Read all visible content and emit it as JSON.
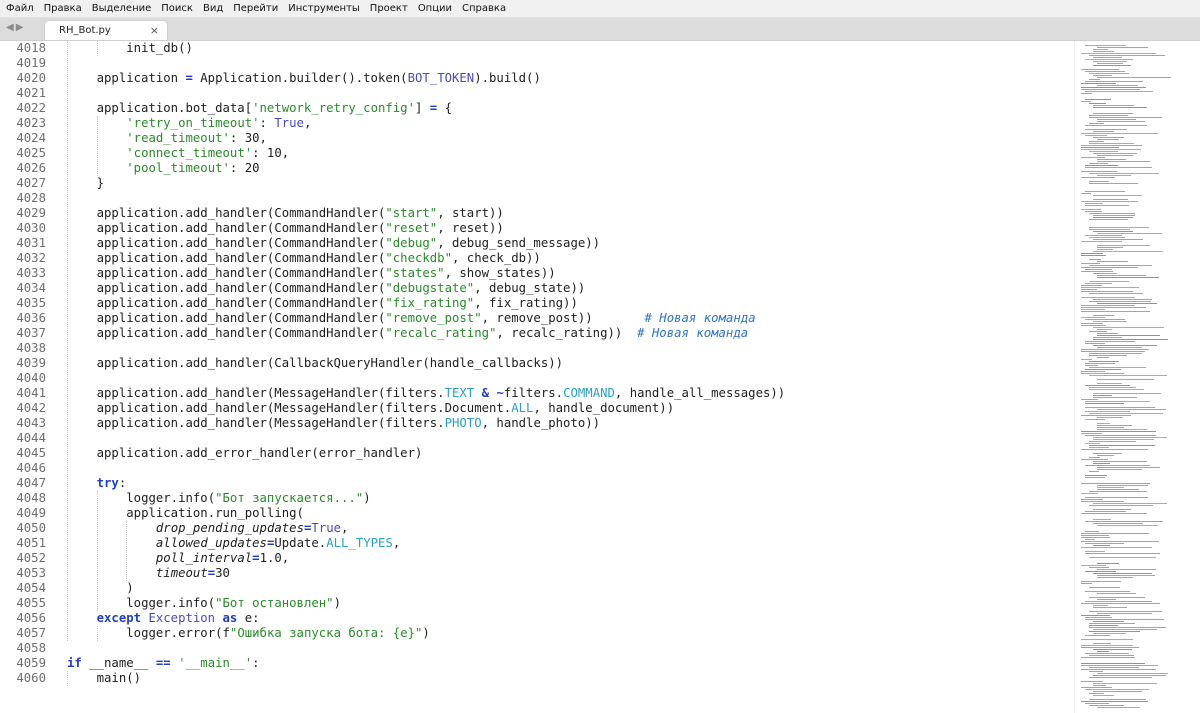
{
  "menu": {
    "items": [
      "Файл",
      "Правка",
      "Выделение",
      "Поиск",
      "Вид",
      "Перейти",
      "Инструменты",
      "Проект",
      "Опции",
      "Справка"
    ]
  },
  "tabbar": {
    "nav_glyph": "◀▶",
    "active_tab": {
      "label": "RH_Bot.py",
      "close_glyph": "×"
    }
  },
  "editor": {
    "lines": [
      {
        "n": "4018",
        "indent": 2,
        "html": "init_db()"
      },
      {
        "n": "4019",
        "indent": 0,
        "html": ""
      },
      {
        "n": "4020",
        "indent": 1,
        "html": "application <span class=\"kw\">=</span> Application.builder().token(<span class=\"nb\">BOT_TOKEN</span>).build()"
      },
      {
        "n": "4021",
        "indent": 0,
        "html": ""
      },
      {
        "n": "4022",
        "indent": 1,
        "html": "application.bot_data[<span class=\"st\">'network_retry_config'</span>] <span class=\"kw\">=</span> {"
      },
      {
        "n": "4023",
        "indent": 2,
        "html": "<span class=\"st\">'retry_on_timeout'</span>: <span class=\"nb\">True</span>,"
      },
      {
        "n": "4024",
        "indent": 2,
        "html": "<span class=\"st\">'read_timeout'</span>: 30,"
      },
      {
        "n": "4025",
        "indent": 2,
        "html": "<span class=\"st\">'connect_timeout'</span>: 10,"
      },
      {
        "n": "4026",
        "indent": 2,
        "html": "<span class=\"st\">'pool_timeout'</span>: 20"
      },
      {
        "n": "4027",
        "indent": 1,
        "html": "}"
      },
      {
        "n": "4028",
        "indent": 0,
        "html": ""
      },
      {
        "n": "4029",
        "indent": 1,
        "html": "application.add_handler(CommandHandler(<span class=\"st\">\"start\"</span>, start))"
      },
      {
        "n": "4030",
        "indent": 1,
        "html": "application.add_handler(CommandHandler(<span class=\"st\">\"reset\"</span>, reset))"
      },
      {
        "n": "4031",
        "indent": 1,
        "html": "application.add_handler(CommandHandler(<span class=\"st\">\"debug\"</span>, debug_send_message))"
      },
      {
        "n": "4032",
        "indent": 1,
        "html": "application.add_handler(CommandHandler(<span class=\"st\">\"checkdb\"</span>, check_db))"
      },
      {
        "n": "4033",
        "indent": 1,
        "html": "application.add_handler(CommandHandler(<span class=\"st\">\"states\"</span>, show_states))"
      },
      {
        "n": "4034",
        "indent": 1,
        "html": "application.add_handler(CommandHandler(<span class=\"st\">\"debugstate\"</span>, debug_state))"
      },
      {
        "n": "4035",
        "indent": 1,
        "html": "application.add_handler(CommandHandler(<span class=\"st\">\"fix_rating\"</span>, fix_rating))"
      },
      {
        "n": "4036",
        "indent": 1,
        "html": "application.add_handler(CommandHandler(<span class=\"st\">\"remove_post\"</span>, remove_post))       <span class=\"cm\"># Новая команда</span>"
      },
      {
        "n": "4037",
        "indent": 1,
        "html": "application.add_handler(CommandHandler(<span class=\"st\">\"recalc_rating\"</span>, recalc_rating))  <span class=\"cm\"># Новая команда</span>"
      },
      {
        "n": "4038",
        "indent": 0,
        "html": ""
      },
      {
        "n": "4039",
        "indent": 1,
        "html": "application.add_handler(CallbackQueryHandler(handle_callbacks))"
      },
      {
        "n": "4040",
        "indent": 0,
        "html": ""
      },
      {
        "n": "4041",
        "indent": 1,
        "html": "application.add_handler(MessageHandler(filters.<span class=\"cyan\">TEXT</span> <span class=\"kw\">&amp;</span> <span class=\"kw\">~</span>filters.<span class=\"cyan\">COMMAND</span>, handle_all_messages))"
      },
      {
        "n": "4042",
        "indent": 1,
        "html": "application.add_handler(MessageHandler(filters.Document.<span class=\"cyan\">ALL</span>, handle_document))"
      },
      {
        "n": "4043",
        "indent": 1,
        "html": "application.add_handler(MessageHandler(filters.<span class=\"cyan\">PHOTO</span>, handle_photo))"
      },
      {
        "n": "4044",
        "indent": 0,
        "html": ""
      },
      {
        "n": "4045",
        "indent": 1,
        "html": "application.add_error_handler(error_handler)"
      },
      {
        "n": "4046",
        "indent": 0,
        "html": ""
      },
      {
        "n": "4047",
        "indent": 1,
        "html": "<span class=\"kw\">try</span>:"
      },
      {
        "n": "4048",
        "indent": 2,
        "html": "logger.info(<span class=\"st\">\"Бот запускается...\"</span>)"
      },
      {
        "n": "4049",
        "indent": 2,
        "html": "application.run_polling("
      },
      {
        "n": "4050",
        "indent": 3,
        "html": "<span class=\"it\">drop_pending_updates</span><span class=\"kw\">=</span><span class=\"nb\">True</span>,"
      },
      {
        "n": "4051",
        "indent": 3,
        "html": "<span class=\"it\">allowed_updates</span><span class=\"kw\">=</span>Update.<span class=\"cyan\">ALL_TYPES</span>,"
      },
      {
        "n": "4052",
        "indent": 3,
        "html": "<span class=\"it\">poll_interval</span><span class=\"kw\">=</span>1.0,"
      },
      {
        "n": "4053",
        "indent": 3,
        "html": "<span class=\"it\">timeout</span><span class=\"kw\">=</span>30"
      },
      {
        "n": "4054",
        "indent": 2,
        "html": ")"
      },
      {
        "n": "4055",
        "indent": 2,
        "html": "logger.info(<span class=\"st\">\"Бот остановлен\"</span>)"
      },
      {
        "n": "4056",
        "indent": 1,
        "html": "<span class=\"kw\">except</span> <span class=\"nb\">Exception</span> <span class=\"kw\">as</span> e:"
      },
      {
        "n": "4057",
        "indent": 2,
        "html": "logger.error(f<span class=\"st\">\"Ошибка запуска бота: {e}\"</span>)"
      },
      {
        "n": "4058",
        "indent": 0,
        "html": ""
      },
      {
        "n": "4059",
        "indent": 0,
        "html": "<span class=\"kw\">if</span> __name__ <span class=\"kw\">==</span> <span class=\"st\">'__main__'</span>:"
      },
      {
        "n": "4060",
        "indent": 1,
        "html": "main()"
      }
    ]
  },
  "colors": {
    "keyword": "#1f3fbf",
    "string": "#2a8a2a",
    "builtin": "#4a4ac0",
    "comment": "#2f74c8",
    "constant": "#2aa1c0",
    "line_number": "#6f6f6f"
  }
}
